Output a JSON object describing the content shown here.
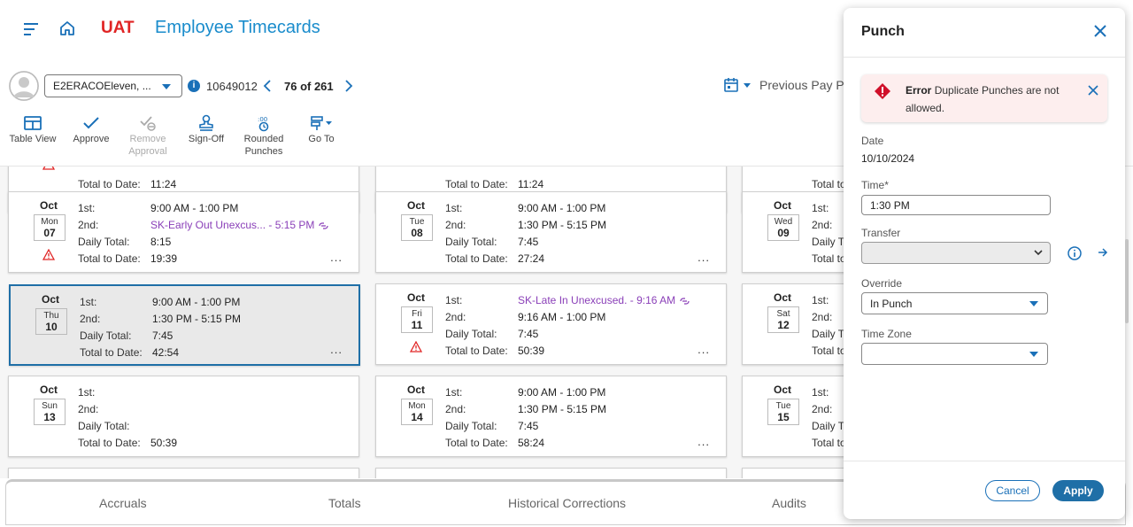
{
  "header": {
    "environment": "UAT",
    "title": "Employee Timecards"
  },
  "employee": {
    "name": "E2ERACOEleven, ...",
    "id": "10649012",
    "counter": "76 of 261",
    "pay_period": "Previous Pay P"
  },
  "toolbar": {
    "table_view": "Table View",
    "approve": "Approve",
    "remove_approval_1": "Remove",
    "remove_approval_2": "Approval",
    "sign_off": "Sign-Off",
    "rounded_1": "Rounded",
    "rounded_2": "Punches",
    "go_to": "Go To"
  },
  "labels": {
    "first": "1st:",
    "second": "2nd:",
    "daily_total": "Daily Total:",
    "total_to_date": "Total to Date:"
  },
  "partial_row": {
    "c1_total": "11:24",
    "c2_total": "11:24"
  },
  "cards": [
    {
      "month": "Oct",
      "dow": "Mon",
      "day": "07",
      "first": "9:00 AM  -  1:00 PM",
      "second_exception": "SK-Early Out Unexcus...",
      "second_time": "  -  5:15 PM",
      "daily": "8:15",
      "ttd": "19:39",
      "warning": true
    },
    {
      "month": "Oct",
      "dow": "Tue",
      "day": "08",
      "first": "9:00 AM  -  1:00 PM",
      "second": "1:30 PM  -  5:15 PM",
      "daily": "7:45",
      "ttd": "27:24"
    },
    {
      "month": "Oct",
      "dow": "Wed",
      "day": "09"
    },
    {
      "month": "Oct",
      "dow": "Thu",
      "day": "10",
      "first": "9:00 AM  -  1:00 PM",
      "second": "1:30 PM  -  5:15 PM",
      "daily": "7:45",
      "ttd": "42:54",
      "selected": true
    },
    {
      "month": "Oct",
      "dow": "Fri",
      "day": "11",
      "first_exception": "SK-Late In Unexcused.",
      "first_time": "  -  9:16 AM",
      "second": "9:16 AM  -  1:00 PM",
      "daily": "7:45",
      "ttd": "50:39",
      "warning": true
    },
    {
      "month": "Oct",
      "dow": "Sat",
      "day": "12"
    },
    {
      "month": "Oct",
      "dow": "Sun",
      "day": "13",
      "ttd": "50:39"
    },
    {
      "month": "Oct",
      "dow": "Mon",
      "day": "14",
      "first": "9:00 AM  -  1:00 PM",
      "second": "1:30 PM  -  5:15 PM",
      "daily": "7:45",
      "ttd": "58:24"
    },
    {
      "month": "Oct",
      "dow": "Tue",
      "day": "15"
    }
  ],
  "bottom_tabs": [
    "Accruals",
    "Totals",
    "Historical Corrections",
    "Audits"
  ],
  "panel": {
    "title": "Punch",
    "error_title": "Error",
    "error_msg": "Duplicate Punches are not allowed.",
    "date_label": "Date",
    "date_value": "10/10/2024",
    "time_label": "Time*",
    "time_value": "1:30 PM",
    "transfer_label": "Transfer",
    "override_label": "Override",
    "override_value": "In Punch",
    "timezone_label": "Time Zone",
    "cancel": "Cancel",
    "apply": "Apply"
  },
  "colors": {
    "brand_blue": "#1a8ccc",
    "env_red": "#e02424",
    "exception_purple": "#8a3fb8",
    "selected_border": "#1f6fa7"
  }
}
